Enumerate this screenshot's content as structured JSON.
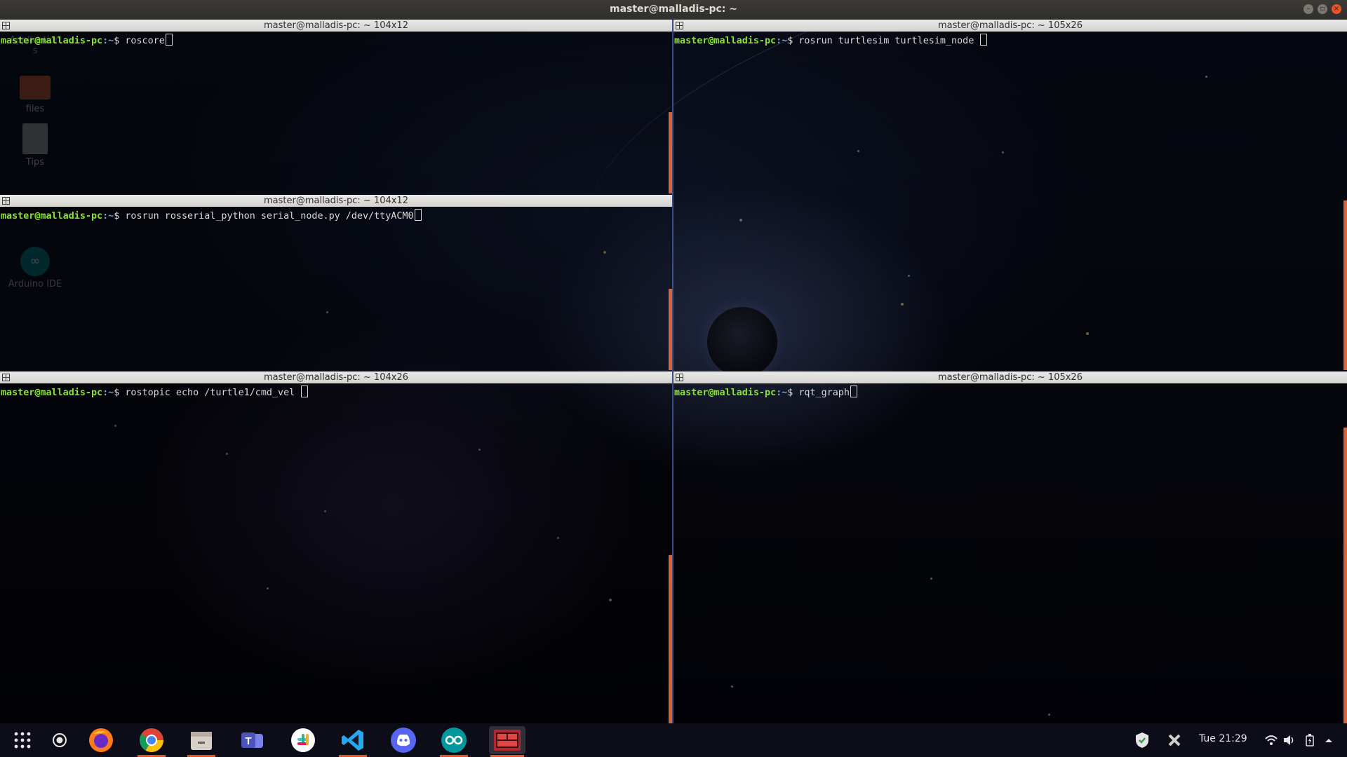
{
  "window": {
    "title": "master@malladis-pc: ~"
  },
  "desktop_icons": [
    {
      "label": "Application\ns",
      "icon": "applications-icon"
    },
    {
      "label": "files",
      "icon": "folder-icon"
    },
    {
      "label": "Tips",
      "icon": "document-icon"
    },
    {
      "label": "Arduino IDE",
      "icon": "arduino-icon"
    }
  ],
  "panes": [
    {
      "title": "master@malladis-pc: ~ 104x12",
      "user": "master@malladis-pc",
      "path": ":~",
      "symbol": "$",
      "command": " roscore"
    },
    {
      "title": "master@malladis-pc: ~ 105x26",
      "user": "master@malladis-pc",
      "path": ":~",
      "symbol": "$",
      "command": " rosrun turtlesim turtlesim_node "
    },
    {
      "title": "master@malladis-pc: ~ 104x12",
      "user": "master@malladis-pc",
      "path": ":~",
      "symbol": "$",
      "command": " rosrun rosserial_python serial_node.py /dev/ttyACM0"
    },
    {
      "title": "master@malladis-pc: ~ 104x26",
      "user": "master@malladis-pc",
      "path": ":~",
      "symbol": "$",
      "command": " rostopic echo /turtle1/cmd_vel "
    },
    {
      "title": "master@malladis-pc: ~ 105x26",
      "user": "master@malladis-pc",
      "path": ":~",
      "symbol": "$",
      "command": " rqt_graph"
    }
  ],
  "taskbar": {
    "apps": [
      "app-grid-icon",
      "screen-recorder-icon",
      "firefox-icon",
      "chrome-icon",
      "files-icon",
      "teams-icon",
      "slack-icon",
      "vscode-icon",
      "discord-icon",
      "arduino-icon",
      "terminator-icon"
    ],
    "clock": "Tue 21:29"
  },
  "colors": {
    "accent": "#e95420",
    "prompt_user": "#8ae234",
    "prompt_path": "#729fcf"
  }
}
